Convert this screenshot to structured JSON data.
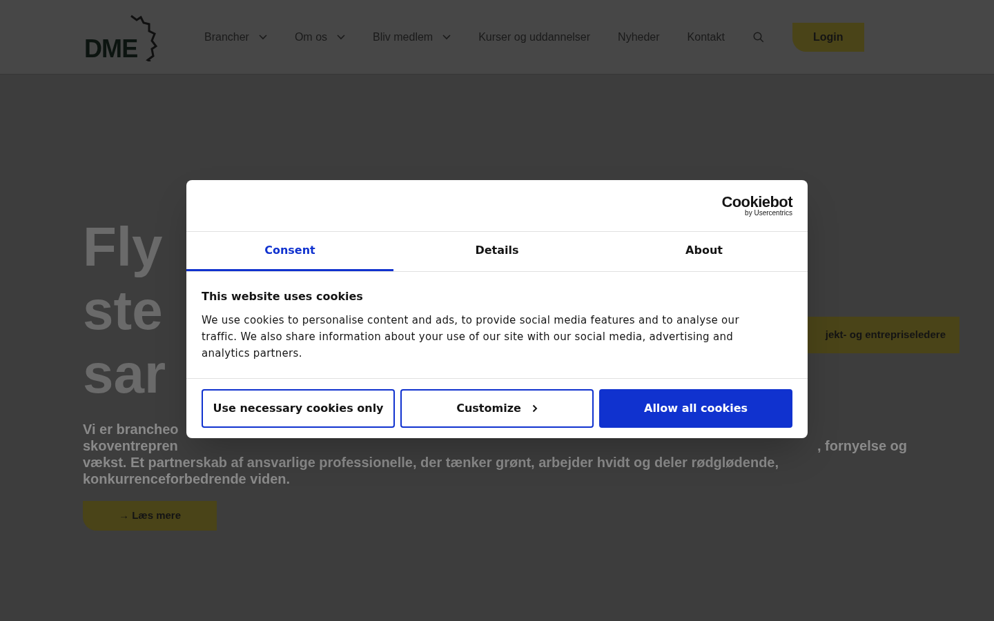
{
  "header": {
    "logo": "DME",
    "nav": [
      {
        "label": "Brancher",
        "dropdown": true
      },
      {
        "label": "Om os",
        "dropdown": true
      },
      {
        "label": "Bliv medlem",
        "dropdown": true
      },
      {
        "label": "Kurser og uddannelser",
        "dropdown": false
      },
      {
        "label": "Nyheder",
        "dropdown": false
      },
      {
        "label": "Kontakt",
        "dropdown": false
      }
    ],
    "login": "Login"
  },
  "hero": {
    "headline_lines": [
      "Fly",
      "ste",
      "sar"
    ],
    "side_button": "jekt- og entrepriseledere",
    "paragraph_line_1": "Vi er brancheo",
    "paragraph_line_2_left": "skoventrepren",
    "paragraph_line_2_right": ", fornyelse og",
    "paragraph_rest": "vækst. Et partnerskab af ansvarlige professionelle, der tænker grønt, arbejder hvidt og deler rødglødende, konkurrenceforbedrende viden.",
    "cta": "→ Læs mere"
  },
  "cookie_dialog": {
    "brand": "Cookiebot",
    "brand_sub": "by Usercentrics",
    "tabs": [
      {
        "label": "Consent",
        "selected": true
      },
      {
        "label": "Details",
        "selected": false
      },
      {
        "label": "About",
        "selected": false
      }
    ],
    "title": "This website uses cookies",
    "text": "We use cookies to personalise content and ads, to provide social media features and to analyse our traffic. We also share information about your use of our site with our social media, advertising and analytics partners.",
    "buttons": [
      {
        "label": "Use necessary cookies only",
        "kind": "outline"
      },
      {
        "label": "Customize",
        "kind": "chevron"
      },
      {
        "label": "Allow all cookies",
        "kind": "primary"
      }
    ]
  }
}
